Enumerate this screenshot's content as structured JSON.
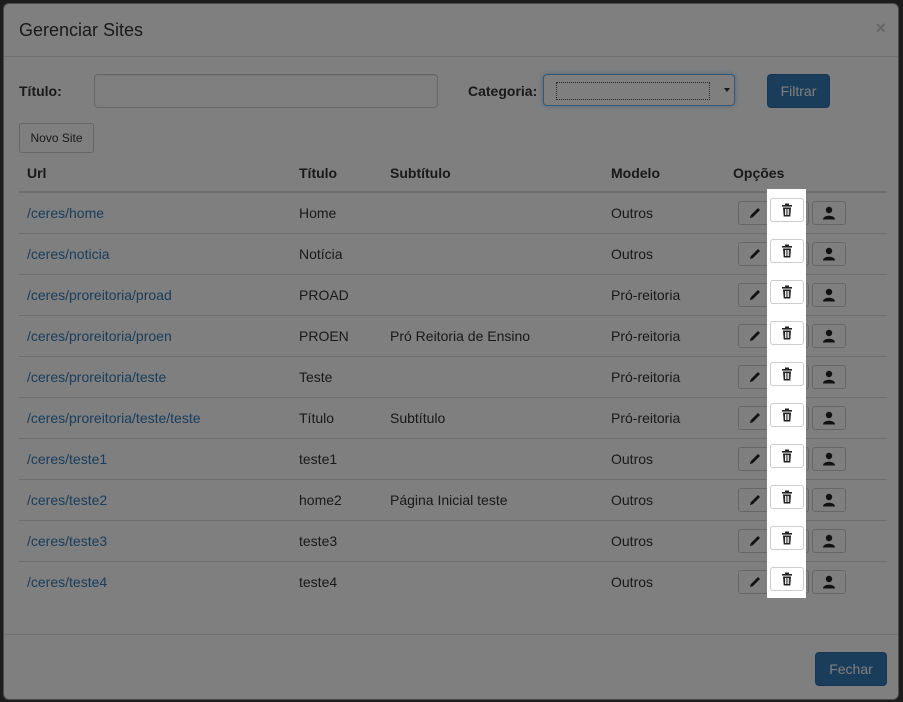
{
  "modal": {
    "title": "Gerenciar Sites",
    "close_label": "×"
  },
  "filters": {
    "titulo_label": "Título:",
    "titulo_value": "",
    "categoria_label": "Categoria:",
    "categoria_value": "",
    "filter_button": "Filtrar"
  },
  "new_site_button": "Novo Site",
  "table": {
    "headers": [
      "Url",
      "Título",
      "Subtítulo",
      "Modelo",
      "Opções"
    ],
    "rows": [
      {
        "url": "/ceres/home",
        "titulo": "Home",
        "subtitulo": "",
        "modelo": "Outros"
      },
      {
        "url": "/ceres/noticia",
        "titulo": "Notícia",
        "subtitulo": "",
        "modelo": "Outros"
      },
      {
        "url": "/ceres/proreitoria/proad",
        "titulo": "PROAD",
        "subtitulo": "",
        "modelo": "Pró-reitoria"
      },
      {
        "url": "/ceres/proreitoria/proen",
        "titulo": "PROEN",
        "subtitulo": "Pró Reitoria de Ensino",
        "modelo": "Pró-reitoria"
      },
      {
        "url": "/ceres/proreitoria/teste",
        "titulo": "Teste",
        "subtitulo": "",
        "modelo": "Pró-reitoria"
      },
      {
        "url": "/ceres/proreitoria/teste/teste",
        "titulo": "Título",
        "subtitulo": "Subtítulo",
        "modelo": "Pró-reitoria"
      },
      {
        "url": "/ceres/teste1",
        "titulo": "teste1",
        "subtitulo": "",
        "modelo": "Outros"
      },
      {
        "url": "/ceres/teste2",
        "titulo": "home2",
        "subtitulo": "Página Inicial teste",
        "modelo": "Outros"
      },
      {
        "url": "/ceres/teste3",
        "titulo": "teste3",
        "subtitulo": "",
        "modelo": "Outros"
      },
      {
        "url": "/ceres/teste4",
        "titulo": "teste4",
        "subtitulo": "",
        "modelo": "Outros"
      }
    ],
    "row_icons": [
      "pencil-icon",
      "trash-icon",
      "user-icon"
    ]
  },
  "footer": {
    "close_button": "Fechar"
  },
  "colors": {
    "primary": "#337ab7",
    "link": "#337ab7",
    "overlay": "rgba(0,0,0,0.5)"
  }
}
